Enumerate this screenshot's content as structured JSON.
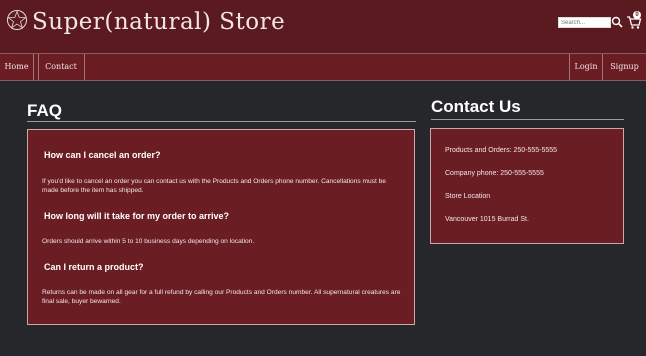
{
  "header": {
    "title": "Super(natural) Store",
    "search_placeholder": "Search...",
    "cart_count": "0"
  },
  "nav": {
    "home": "Home",
    "contact": "Contact",
    "login": "Login",
    "signup": "Signup"
  },
  "faq": {
    "heading": "FAQ",
    "items": [
      {
        "question": "How can I cancel an order?",
        "answer": "If you'd like to cancel an order you can contact us with the Products and Orders phone number. Cancellations must be made before the item has shipped."
      },
      {
        "question": "How long will it take for my order to arrive?",
        "answer": "Orders should arrive within 5 to 10 business days depending on location."
      },
      {
        "question": "Can I return a product?",
        "answer": "Returns can be made on all gear for a full refund by calling our Products and Orders number. All supernatural creatures are final sale, buyer bewarned."
      }
    ]
  },
  "contact": {
    "heading": "Contact Us",
    "lines": [
      "Products and Orders: 250-555-5555",
      "Company phone: 250-555-5555",
      "Store Location",
      "Vancouver 1015 Burrad St."
    ]
  },
  "colors": {
    "header_bg": "#5a1a1f",
    "nav_bg": "#6b1d24",
    "panel_bg": "#6b1d24",
    "page_bg": "#26272b"
  },
  "icons": [
    "pentagram-logo-icon",
    "search-icon",
    "cart-icon"
  ]
}
